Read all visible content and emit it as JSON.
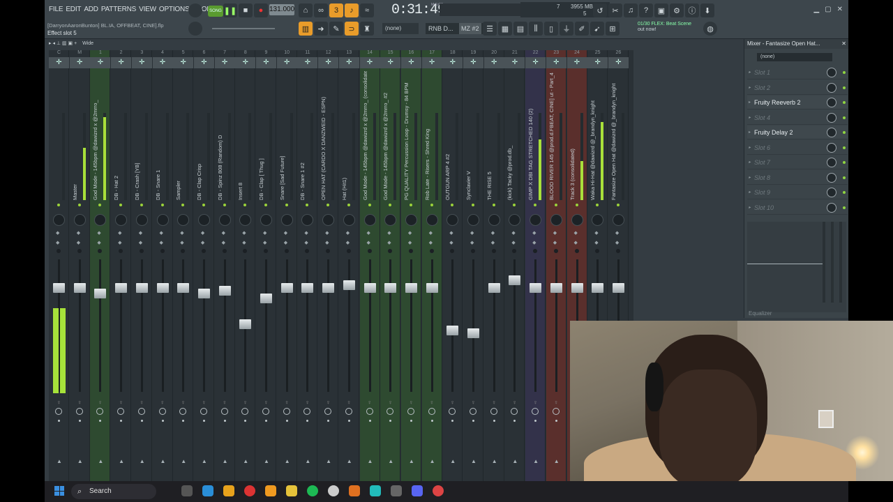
{
  "menu": [
    "FILE",
    "EDIT",
    "ADD",
    "PATTERNS",
    "VIEW",
    "OPTIONS",
    "TOOLS",
    "HELP"
  ],
  "transport": {
    "mode": "SONG",
    "tempo": "131.000",
    "time": "0:31:49",
    "time_unit": "M:S:CS"
  },
  "cpu": {
    "voices": "7",
    "memory": "3955 MB",
    "polyphony": "5"
  },
  "project": {
    "file": "[DarryonAaronBunton] BL.IA, OFFBEAT, CINE].flp",
    "hint": "Effect slot 5"
  },
  "toolbar": {
    "snap": "(none)",
    "pattern": "RNB D...",
    "pattern2": "MZ #2"
  },
  "news": {
    "line1": "01/30  FLEX: Beat Scene",
    "line2": "out now!"
  },
  "mixer": {
    "view": "Wide",
    "tracks": [
      {
        "num": "C",
        "name": "",
        "color": "none",
        "fader": 0.82
      },
      {
        "num": "M",
        "name": "Master",
        "color": "none",
        "fader": 0.82
      },
      {
        "num": "1",
        "name": "God Mode - 145bpm @dawizrd x @2mrro_",
        "color": "green",
        "fader": 0.78
      },
      {
        "num": "2",
        "name": "DB - Hat 2",
        "color": "none",
        "fader": 0.82
      },
      {
        "num": "3",
        "name": "DB - Crash [YB]",
        "color": "none",
        "fader": 0.82
      },
      {
        "num": "4",
        "name": "DB - Snare 1",
        "color": "none",
        "fader": 0.82
      },
      {
        "num": "5",
        "name": "Sampler",
        "color": "none",
        "fader": 0.82
      },
      {
        "num": "6",
        "name": "DB - Clap Crisp",
        "color": "none",
        "fader": 0.78
      },
      {
        "num": "7",
        "name": "DB - Spinz 808 (Random) D",
        "color": "none",
        "fader": 0.8
      },
      {
        "num": "8",
        "name": "Insert 8",
        "color": "none",
        "fader": 0.55
      },
      {
        "num": "9",
        "name": "DB - Clap [ Thug ]",
        "color": "none",
        "fader": 0.74
      },
      {
        "num": "10",
        "name": "Snare [Sad Future]",
        "color": "none",
        "fader": 0.82
      },
      {
        "num": "11",
        "name": "DB - Snare 1 #2",
        "color": "none",
        "fader": 0.82
      },
      {
        "num": "12",
        "name": "OPEN HAT (CARDO X DANZWEID - ESPN)",
        "color": "none",
        "fader": 0.82
      },
      {
        "num": "13",
        "name": "Hat (Hit1)",
        "color": "none",
        "fader": 0.84
      },
      {
        "num": "14",
        "name": "God Mode - 145bpm @dawizrd x @2mrro_ (consolidated)",
        "color": "green",
        "fader": 0.82
      },
      {
        "num": "15",
        "name": "God Mode - 145bpm @dawizrd x @2mrro_ #2",
        "color": "green",
        "fader": 0.82
      },
      {
        "num": "16",
        "name": "PG QUALITY Percussion Loop - Drumsy - 84 BPM",
        "color": "green",
        "fader": 0.82
      },
      {
        "num": "17",
        "name": "Rob Late - Risers - Shred King",
        "color": "green",
        "fader": 0.82
      },
      {
        "num": "18",
        "name": "OUTGUN ARP 4 #2",
        "color": "none",
        "fader": 0.5
      },
      {
        "num": "19",
        "name": "Synclavier V",
        "color": "none",
        "fader": 0.48
      },
      {
        "num": "20",
        "name": "THE RISE 5",
        "color": "none",
        "fader": 0.82
      },
      {
        "num": "21",
        "name": "(kick) Tacky @prod.db_",
        "color": "none",
        "fader": 0.88
      },
      {
        "num": "22",
        "name": "GIMP X DBI TAG STRETCHED 140 (2)",
        "color": "purple",
        "fader": 0.82
      },
      {
        "num": "23",
        "name": "BLOOD RIVER 145 @prod.d.FBEAT, CINE] ut - Part_4",
        "color": "red",
        "fader": 0.82
      },
      {
        "num": "24",
        "name": "Track 3 (consolidated)",
        "color": "red",
        "fader": 0.82
      },
      {
        "num": "25",
        "name": "Waka Hi-Hat @dawizrd @_brandyn_knight",
        "color": "none",
        "fader": 0.82
      },
      {
        "num": "26",
        "name": "Fantasize Open Hat @dawizrd @_brandyn_knight",
        "color": "none",
        "fader": 0.82
      }
    ]
  },
  "panel": {
    "title": "Mixer - Fantasize Open Hat...",
    "routing": "(none)",
    "slots": [
      {
        "label": "Slot 1",
        "empty": true
      },
      {
        "label": "Slot 2",
        "empty": true
      },
      {
        "label": "Fruity Reeverb 2",
        "empty": false
      },
      {
        "label": "Slot 4",
        "empty": true
      },
      {
        "label": "Fruity Delay 2",
        "empty": false
      },
      {
        "label": "Slot 6",
        "empty": true
      },
      {
        "label": "Slot 7",
        "empty": true
      },
      {
        "label": "Slot 8",
        "empty": true
      },
      {
        "label": "Slot 9",
        "empty": true
      },
      {
        "label": "Slot 10",
        "empty": true
      }
    ],
    "eq_label": "Equalizer"
  },
  "taskbar": {
    "search": "Search"
  }
}
